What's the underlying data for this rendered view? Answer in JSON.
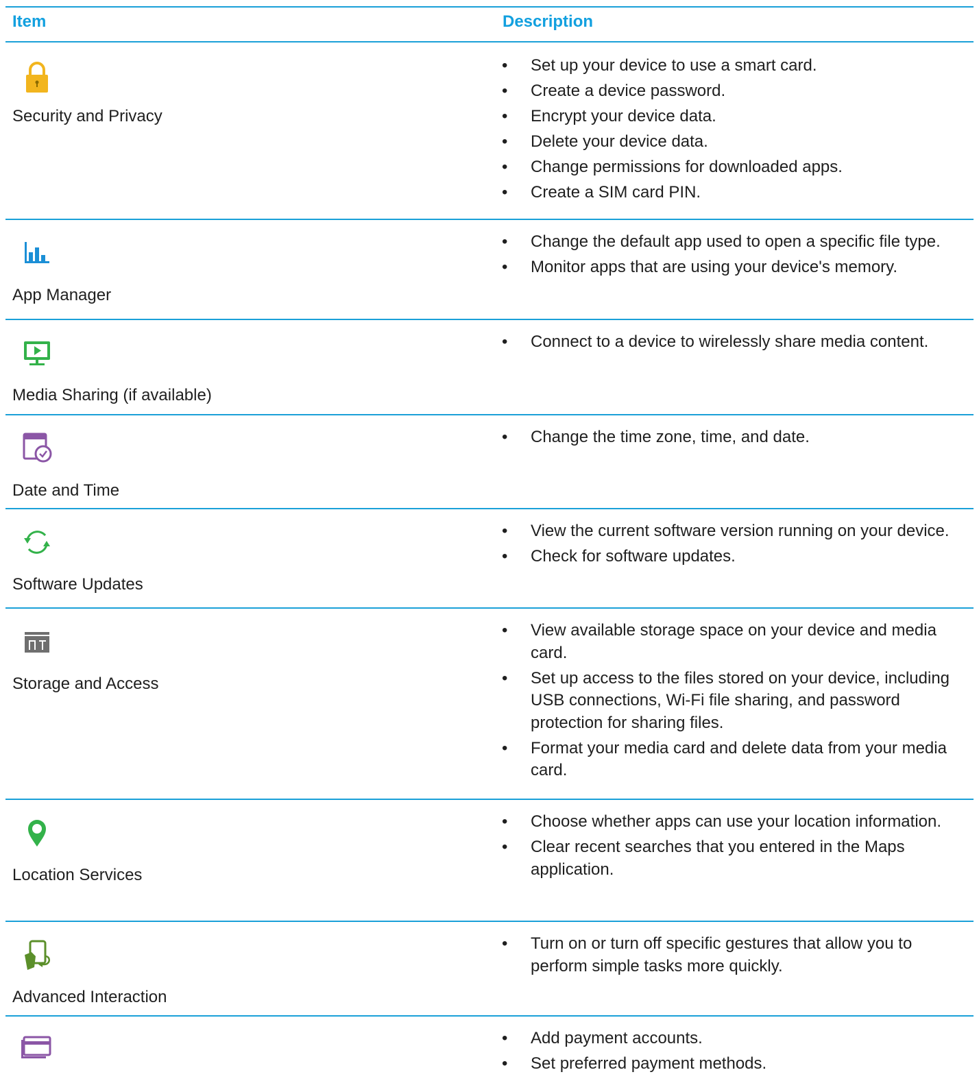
{
  "header": {
    "item": "Item",
    "description": "Description"
  },
  "colors": {
    "accent": "#1aa0d8"
  },
  "rows": [
    {
      "label": "Security and Privacy",
      "icon": "lock-icon",
      "color": "#f2b51e",
      "bullets": [
        "Set up your device to use a smart card.",
        "Create a device password.",
        "Encrypt your device data.",
        "Delete your device data.",
        "Change permissions for downloaded apps.",
        "Create a SIM card PIN."
      ]
    },
    {
      "label": "App Manager",
      "icon": "bar-chart-icon",
      "color": "#1b8fd6",
      "bullets": [
        "Change the default app used to open a specific file type.",
        "Monitor apps that are using your device's memory."
      ]
    },
    {
      "label": "Media Sharing (if available)",
      "icon": "monitor-play-icon",
      "color": "#33b24a",
      "bullets": [
        "Connect to a device to wirelessly share media content."
      ]
    },
    {
      "label": "Date and Time",
      "icon": "calendar-clock-icon",
      "color": "#8b56a6",
      "bullets": [
        "Change the time zone, time, and date."
      ]
    },
    {
      "label": "Software Updates",
      "icon": "sync-arrows-icon",
      "color": "#33b24a",
      "bullets": [
        "View the current software version running on your device.",
        "Check for software updates."
      ]
    },
    {
      "label": "Storage and Access",
      "icon": "storage-icon",
      "color": "#6f6f6f",
      "bullets": [
        "View available storage space on your device and media card.",
        "Set up access to the files stored on your device, including USB connections, Wi-Fi file sharing, and password protection for sharing files.",
        "Format your media card and delete data from your media card."
      ]
    },
    {
      "label": "Location Services",
      "icon": "location-pin-icon",
      "color": "#33b24a",
      "bullets": [
        "Choose whether apps can use your location information.",
        "Clear recent searches that you entered in the Maps application."
      ]
    },
    {
      "label": "Advanced Interaction",
      "icon": "hand-gesture-icon",
      "color": "#5b8f2a",
      "bullets": [
        "Turn on or turn off specific gestures that allow you to perform simple tasks more quickly."
      ]
    },
    {
      "label": "",
      "icon": "payment-card-icon",
      "color": "#8b56a6",
      "bullets": [
        "Add payment accounts.",
        "Set preferred payment methods."
      ]
    }
  ]
}
